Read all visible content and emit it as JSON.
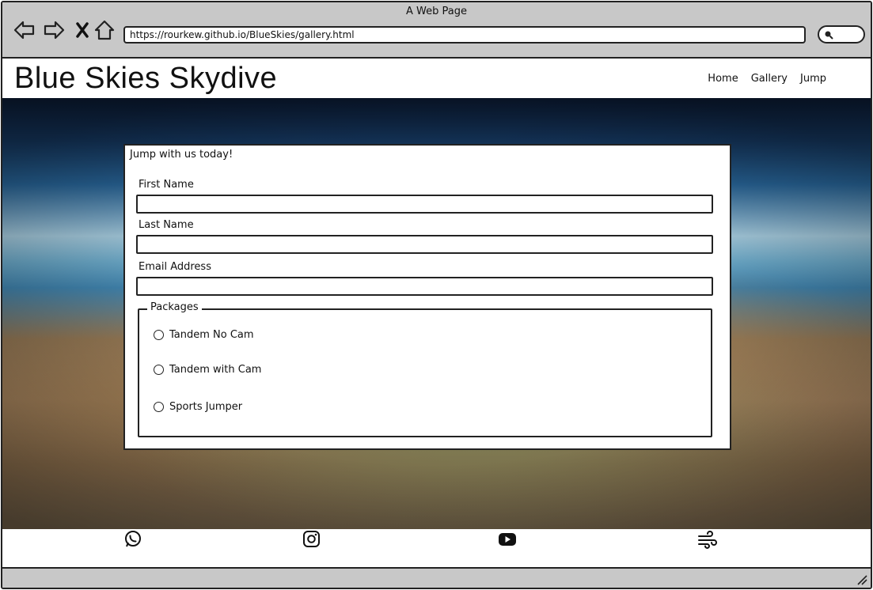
{
  "browser": {
    "window_title": "A Web Page",
    "url": "https://rourkew.github.io/BlueSkies/gallery.html",
    "icons": [
      "back-arrow-icon",
      "forward-arrow-icon",
      "close-x-icon",
      "home-icon",
      "search-icon"
    ]
  },
  "header": {
    "site_title": "Blue Skies Skydive",
    "nav": [
      "Home",
      "Gallery",
      "Jump"
    ]
  },
  "form": {
    "heading": "Jump with us today!",
    "first_name_label": "First Name",
    "first_name_value": "",
    "last_name_label": "Last Name",
    "last_name_value": "",
    "email_label": "Email Address",
    "email_value": "",
    "packages_legend": "Packages",
    "packages": [
      "Tandem No Cam",
      "Tandem with Cam",
      "Sports Jumper"
    ],
    "selected_package": null
  },
  "footer": {
    "social_icons": [
      "whatsapp-icon",
      "instagram-icon",
      "youtube-icon",
      "wind-icon"
    ]
  },
  "colors": {
    "chrome": "#c8c8c8",
    "outline": "#222222"
  }
}
